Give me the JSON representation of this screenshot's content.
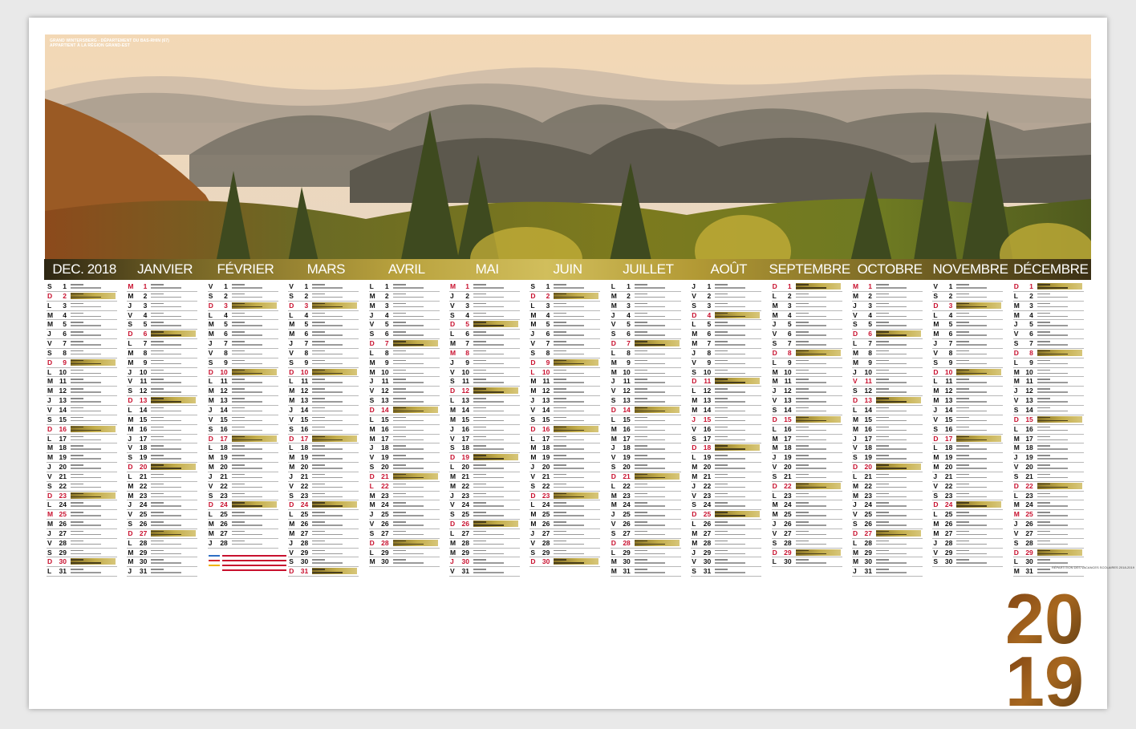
{
  "photo": {
    "caption_line1": "GRAND WINTERSBERG - DÉPARTEMENT DU BAS-RHIN (67)",
    "caption_line2": "APPARTIENT À LA RÉGION GRAND-EST"
  },
  "months": [
    {
      "name": "DEC. 2018",
      "days": 31,
      "start": 5
    },
    {
      "name": "JANVIER",
      "days": 31,
      "start": 1
    },
    {
      "name": "FÉVRIER",
      "days": 28,
      "start": 4
    },
    {
      "name": "MARS",
      "days": 31,
      "start": 4
    },
    {
      "name": "AVRIL",
      "days": 30,
      "start": 0
    },
    {
      "name": "MAI",
      "days": 31,
      "start": 2
    },
    {
      "name": "JUIN",
      "days": 30,
      "start": 5
    },
    {
      "name": "JUILLET",
      "days": 31,
      "start": 0
    },
    {
      "name": "AOÛT",
      "days": 31,
      "start": 3
    },
    {
      "name": "SEPTEMBRE",
      "days": 30,
      "start": 6
    },
    {
      "name": "OCTOBRE",
      "days": 31,
      "start": 1
    },
    {
      "name": "NOVEMBRE",
      "days": 30,
      "start": 4
    },
    {
      "name": "DÉCEMBRE",
      "days": 31,
      "start": 6
    }
  ],
  "weekday_letters": [
    "L",
    "M",
    "M",
    "J",
    "V",
    "S",
    "D"
  ],
  "holiday_days": {
    "0": [
      25
    ],
    "1": [
      1
    ],
    "4": [
      22
    ],
    "5": [
      1,
      8,
      30
    ],
    "6": [
      10
    ],
    "7": [
      14
    ],
    "8": [
      15
    ],
    "10": [
      1,
      11
    ],
    "12": [
      25
    ]
  },
  "footnote": "RÉPARTITION DES VACANCES SCOLAIRES 2018-2019",
  "year": {
    "top": "20",
    "bottom": "19"
  },
  "colors": {
    "holiday_red": "#c8102e",
    "gold": "#c4ae4c"
  }
}
